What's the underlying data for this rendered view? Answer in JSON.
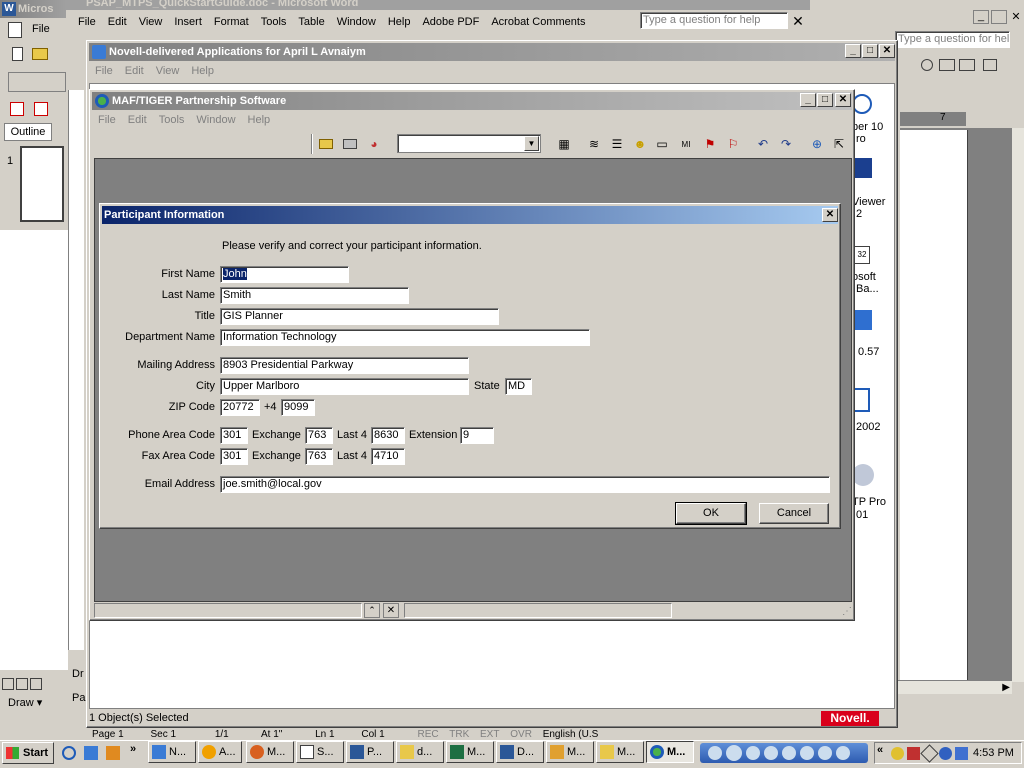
{
  "word": {
    "title": "PSAP_MTPS_QuickStartGuide.doc - Microsoft Word",
    "title_left": "Micros",
    "menu": [
      "File",
      "Edit",
      "View",
      "Insert",
      "Format",
      "Tools",
      "Table",
      "Window",
      "Help",
      "Adobe PDF",
      "Acrobat Comments"
    ],
    "help_placeholder": "Type a question for help",
    "help_placeholder_right": "Type a question for help",
    "file_left": "File",
    "outline_tab": "Outline",
    "page_number": "1",
    "ruler_right": "7",
    "draw_label": "Draw",
    "dr_label": "Dr",
    "pa_label": "Pa",
    "status": [
      "Page 1",
      "Sec 1",
      "1/1",
      "At 1\"",
      "Ln 1",
      "Col 1",
      "REC",
      "TRK",
      "EXT",
      "OVR",
      "English (U.S"
    ]
  },
  "novell": {
    "title": "Novell-delivered Applications for April L Avnaiym",
    "menu": [
      "File",
      "Edit",
      "View",
      "Help"
    ],
    "status": "1 Object(s) Selected",
    "brand": "Novell.",
    "icons_labels": [
      "per 10",
      "ro",
      "Viewer",
      "2",
      "osoft",
      "Ba...",
      "0.57",
      "2002",
      "TP Pro",
      "01"
    ]
  },
  "maf": {
    "title": "MAF/TIGER Partnership Software",
    "menu": [
      "File",
      "Edit",
      "Tools",
      "Window",
      "Help"
    ]
  },
  "dialog": {
    "title": "Participant Information",
    "instruction": "Please verify and correct your participant information.",
    "labels": {
      "first_name": "First Name",
      "last_name": "Last Name",
      "title": "Title",
      "department": "Department Name",
      "mailing": "Mailing Address",
      "city": "City",
      "state": "State",
      "zip": "ZIP Code",
      "plus4": "+4",
      "phone_area": "Phone Area Code",
      "exchange": "Exchange",
      "last4": "Last 4",
      "extension": "Extension",
      "fax_area": "Fax Area Code",
      "email": "Email Address"
    },
    "values": {
      "first_name": "John",
      "last_name": "Smith",
      "title": "GIS Planner",
      "department": "Information Technology",
      "mailing": "8903 Presidential Parkway",
      "city": "Upper Marlboro",
      "state": "MD",
      "zip": "20772",
      "zip4": "9099",
      "phone_area": "301",
      "phone_exchange": "763",
      "phone_last4": "8630",
      "phone_ext": "9",
      "fax_area": "301",
      "fax_exchange": "763",
      "fax_last4": "4710",
      "email": "joe.smith@local.gov"
    },
    "ok": "OK",
    "cancel": "Cancel"
  },
  "taskbar": {
    "start": "Start",
    "chevron": "»",
    "buttons": [
      "N...",
      "A...",
      "M...",
      "S...",
      "P...",
      "d...",
      "M...",
      "D...",
      "M...",
      "M...",
      "M..."
    ],
    "clock": "4:53 PM"
  },
  "colors": {
    "active_title_start": "#0a246a",
    "active_title_end": "#a6caf0",
    "novell_red": "#d9001b",
    "face": "#d4d0c8"
  }
}
